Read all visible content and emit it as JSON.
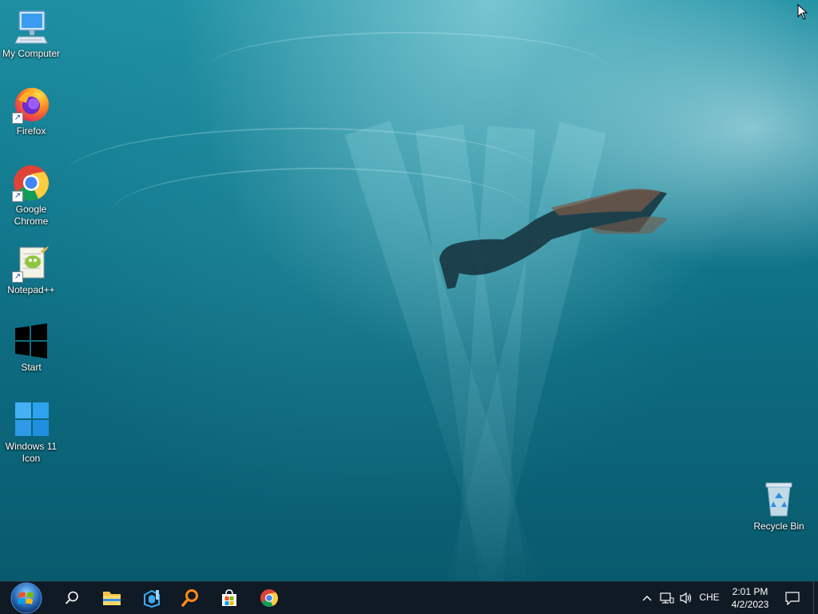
{
  "desktop": {
    "icons": [
      {
        "label": "My Computer",
        "icon": "computer-icon"
      },
      {
        "label": "Firefox",
        "icon": "firefox-icon"
      },
      {
        "label": "Google Chrome",
        "icon": "chrome-icon"
      },
      {
        "label": "Notepad++",
        "icon": "notepadpp-icon"
      },
      {
        "label": "Start",
        "icon": "windows-logo-icon"
      },
      {
        "label": "Windows 11 Icon",
        "icon": "windows11-logo-icon"
      },
      {
        "label": "Recycle Bin",
        "icon": "recycle-bin-icon"
      }
    ]
  },
  "taskbar": {
    "apps": [
      "start-orb-icon",
      "search-icon",
      "file-explorer-icon",
      "dev-tool-icon",
      "orange-search-tool-icon",
      "store-icon",
      "chrome-icon"
    ],
    "tray": {
      "language": "CHE",
      "time": "2:01 PM",
      "date": "4/2/2023"
    }
  },
  "colors": {
    "taskbar": "#0f1a24",
    "water": "#137d92",
    "accent_blue": "#1f8fe0"
  }
}
